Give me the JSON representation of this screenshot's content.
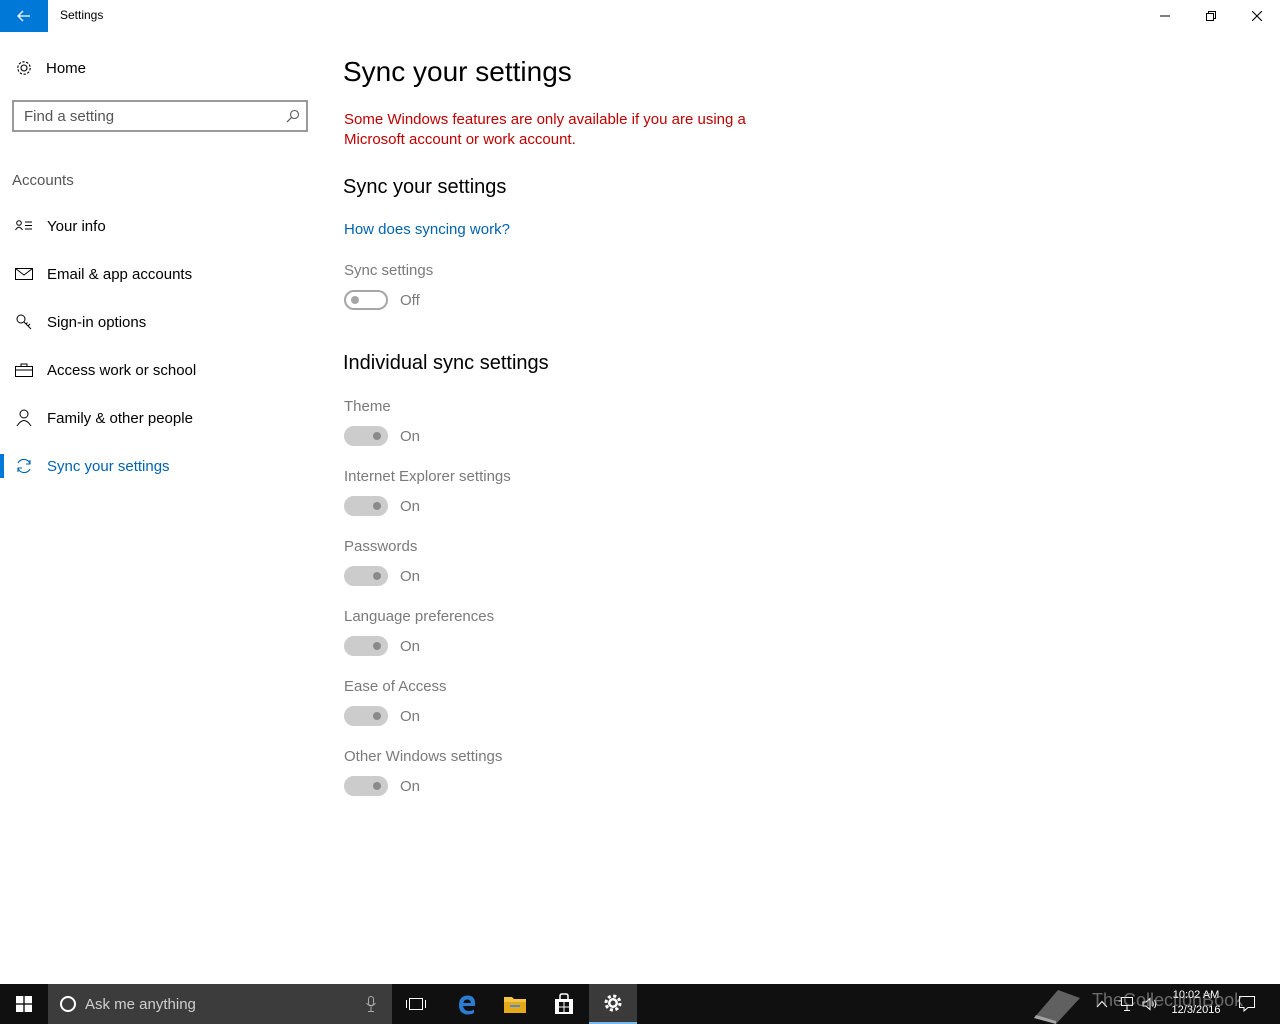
{
  "window": {
    "title": "Settings",
    "back_icon": "arrow-left-icon",
    "controls": [
      "minimize-icon",
      "restore-icon",
      "close-icon"
    ]
  },
  "sidebar": {
    "home_label": "Home",
    "search_placeholder": "Find a setting",
    "section_label": "Accounts",
    "items": [
      {
        "label": "Your info",
        "icon": "contact-card-icon"
      },
      {
        "label": "Email & app accounts",
        "icon": "mail-icon"
      },
      {
        "label": "Sign-in options",
        "icon": "key-icon"
      },
      {
        "label": "Access work or school",
        "icon": "briefcase-icon"
      },
      {
        "label": "Family & other people",
        "icon": "person-icon"
      },
      {
        "label": "Sync your settings",
        "icon": "sync-icon",
        "active": true
      }
    ]
  },
  "main": {
    "title": "Sync your settings",
    "warning": "Some Windows features are only available if you are using a Microsoft account or work account.",
    "sync_section": {
      "heading": "Sync your settings",
      "link": "How does syncing work?",
      "toggle_label": "Sync settings",
      "toggle_state": "Off"
    },
    "individual": {
      "heading": "Individual sync settings",
      "items": [
        {
          "label": "Theme",
          "state": "On"
        },
        {
          "label": "Internet Explorer settings",
          "state": "On"
        },
        {
          "label": "Passwords",
          "state": "On"
        },
        {
          "label": "Language preferences",
          "state": "On"
        },
        {
          "label": "Ease of Access",
          "state": "On"
        },
        {
          "label": "Other Windows settings",
          "state": "On"
        }
      ]
    }
  },
  "taskbar": {
    "cortana_text": "Ask me anything",
    "clock_time": "10:02 AM",
    "clock_date": "12/3/2016",
    "watermark": "TheCollectionBook"
  },
  "colors": {
    "accent": "#0078d7",
    "link": "#0063b1",
    "warning": "#c00000",
    "taskbar": "#101010"
  }
}
